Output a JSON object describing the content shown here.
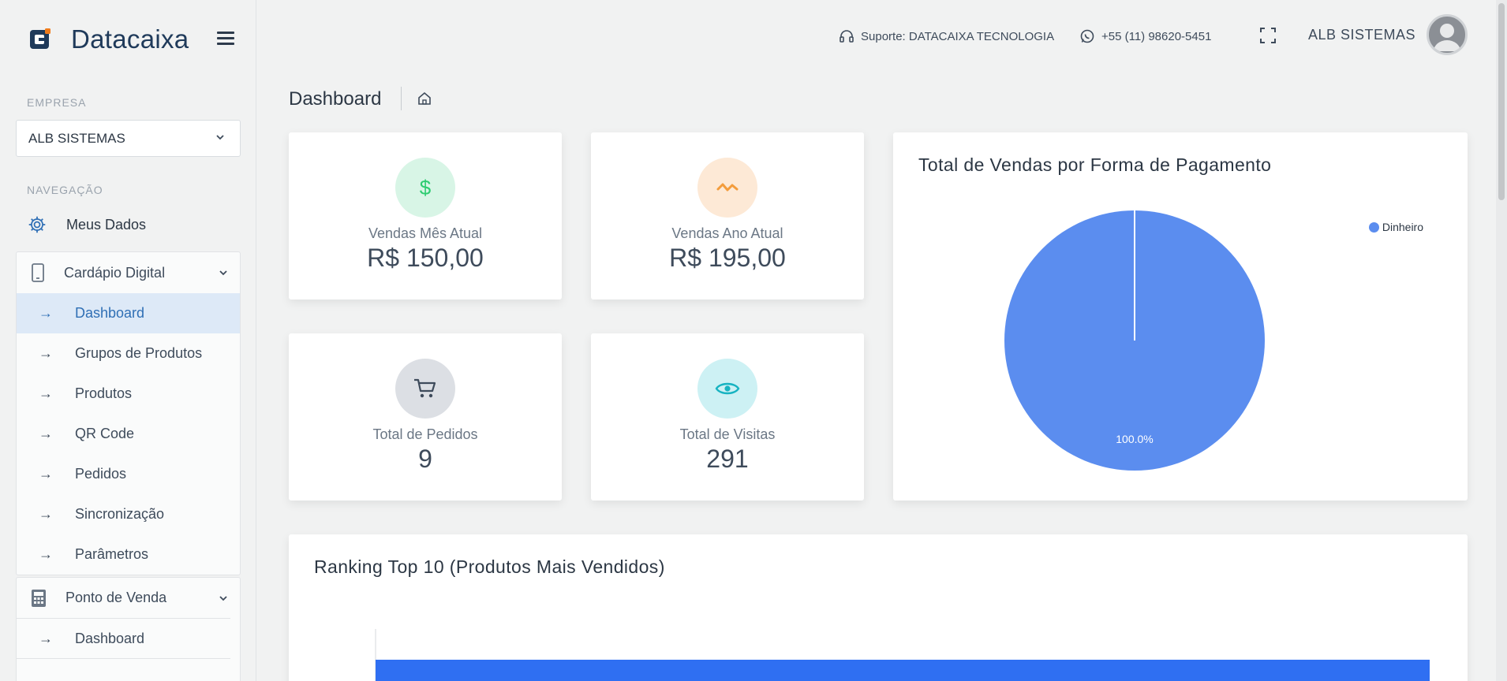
{
  "brand": {
    "name": "Datacaixa"
  },
  "sidebar": {
    "empresa_label": "EMPRESA",
    "empresa_value": "ALB SISTEMAS",
    "nav_label": "NAVEGAÇÃO",
    "meus_dados": "Meus Dados",
    "cardapio": {
      "title": "Cardápio Digital",
      "items": [
        "Dashboard",
        "Grupos de Produtos",
        "Produtos",
        "QR Code",
        "Pedidos",
        "Sincronização",
        "Parâmetros"
      ],
      "active_index": 0
    },
    "pdv": {
      "title": "Ponto de Venda",
      "items": [
        "Dashboard"
      ]
    }
  },
  "topbar": {
    "support": "Suporte: DATACAIXA TECNOLOGIA",
    "phone": "+55 (11) 98620-5451",
    "user": "ALB SISTEMAS"
  },
  "page": {
    "title": "Dashboard"
  },
  "stats": [
    {
      "label": "Vendas Mês Atual",
      "value": "R$ 150,00",
      "icon": "dollar-icon",
      "color": "#2ecc71",
      "bg": "#d8f5e6"
    },
    {
      "label": "Vendas Ano Atual",
      "value": "R$ 195,00",
      "icon": "activity-icon",
      "color": "#f39c3c",
      "bg": "#fde9d6"
    },
    {
      "label": "Total de Pedidos",
      "value": "9",
      "icon": "cart-icon",
      "color": "#3e4b5b",
      "bg": "#dcdfe4"
    },
    {
      "label": "Total de Visitas",
      "value": "291",
      "icon": "eye-icon",
      "color": "#17b3c1",
      "bg": "#cdf1f4"
    }
  ],
  "pie_card": {
    "title": "Total de Vendas por Forma de Pagamento"
  },
  "ranking_card": {
    "title": "Ranking Top 10 (Produtos Mais Vendidos)"
  },
  "chart_data": [
    {
      "type": "pie",
      "title": "Total de Vendas por Forma de Pagamento",
      "categories": [
        "Dinheiro"
      ],
      "values": [
        100.0
      ],
      "labels": [
        "100.0%"
      ],
      "colors": [
        "#5b8def"
      ],
      "legend": "top-right"
    },
    {
      "type": "bar",
      "title": "Ranking Top 10 (Produtos Mais Vendidos)",
      "orientation": "horizontal",
      "colors": [
        "#2f6ff2"
      ]
    }
  ]
}
